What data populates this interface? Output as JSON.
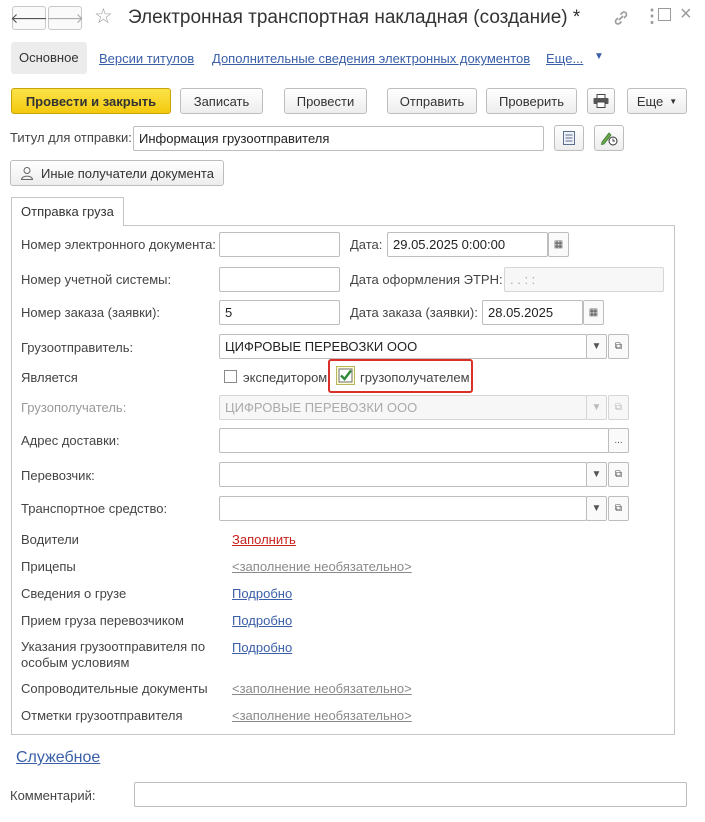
{
  "window": {
    "title": "Электронная транспортная накладная (создание) *"
  },
  "nav_tabs": {
    "main": "Основное",
    "versions": "Версии титулов",
    "extra": "Дополнительные сведения электронных документов",
    "more": "Еще..."
  },
  "toolbar": {
    "post_close": "Провести и закрыть",
    "save": "Записать",
    "post": "Провести",
    "send": "Отправить",
    "check": "Проверить",
    "more": "Еще"
  },
  "title_field": {
    "label": "Титул для отправки:",
    "value": "Информация грузоотправителя"
  },
  "other_recipients": "Иные получатели документа",
  "tab": "Отправка груза",
  "form": {
    "doc_number_label": "Номер электронного документа:",
    "doc_number_value": "",
    "date_label": "Дата:",
    "date_value": "29.05.2025  0:00:00",
    "account_number_label": "Номер учетной системы:",
    "account_number_value": "",
    "etrn_date_label": "Дата оформления ЭТРН:",
    "etrn_date_value": "  .  .        :  :",
    "order_number_label": "Номер заказа (заявки):",
    "order_number_value": "5",
    "order_date_label": "Дата заказа (заявки):",
    "order_date_value": "28.05.2025",
    "shipper_label": "Грузоотправитель:",
    "shipper_value": "ЦИФРОВЫЕ ПЕРЕВОЗКИ ООО",
    "is_label": "Является",
    "forwarder_label": "экспедитором",
    "forwarder_checked": false,
    "consignee_check_label": "грузополучателем",
    "consignee_checked": true,
    "consignee_label": "Грузополучатель:",
    "consignee_value": "ЦИФРОВЫЕ ПЕРЕВОЗКИ ООО",
    "address_label": "Адрес доставки:",
    "address_value": "",
    "carrier_label": "Перевозчик:",
    "carrier_value": "",
    "vehicle_label": "Транспортное средство:",
    "vehicle_value": "",
    "drivers_label": "Водители",
    "drivers_link": "Заполнить",
    "trailers_label": "Прицепы",
    "trailers_link": "<заполнение необязательно>",
    "cargo_label": "Сведения о грузе",
    "cargo_link": "Подробно",
    "acceptance_label": "Прием груза перевозчиком",
    "acceptance_link": "Подробно",
    "instructions_label_1": "Указания грузоотправителя по",
    "instructions_label_2": "особым условиям",
    "instructions_link": "Подробно",
    "docs_label": "Сопроводительные документы",
    "docs_link": "<заполнение необязательно>",
    "marks_label": "Отметки грузоотправителя",
    "marks_link": "<заполнение необязательно>"
  },
  "service_link": "Служебное",
  "comment": {
    "label": "Комментарий:",
    "value": ""
  },
  "colors": {
    "accent_yellow": "#f3c90d",
    "link_blue": "#3a5fa8",
    "red_link": "#c8231e",
    "highlight_red": "#d9302a",
    "check_green": "#2e8b3a"
  },
  "icons": [
    "back-arrow-icon",
    "forward-arrow-icon",
    "star-icon",
    "link-icon",
    "kebab-menu-icon",
    "maximize-icon",
    "close-icon",
    "print-icon",
    "list-icon",
    "edit-clock-icon",
    "person-icon",
    "calendar-icon",
    "dropdown-icon",
    "open-icon",
    "ellipsis-icon"
  ]
}
